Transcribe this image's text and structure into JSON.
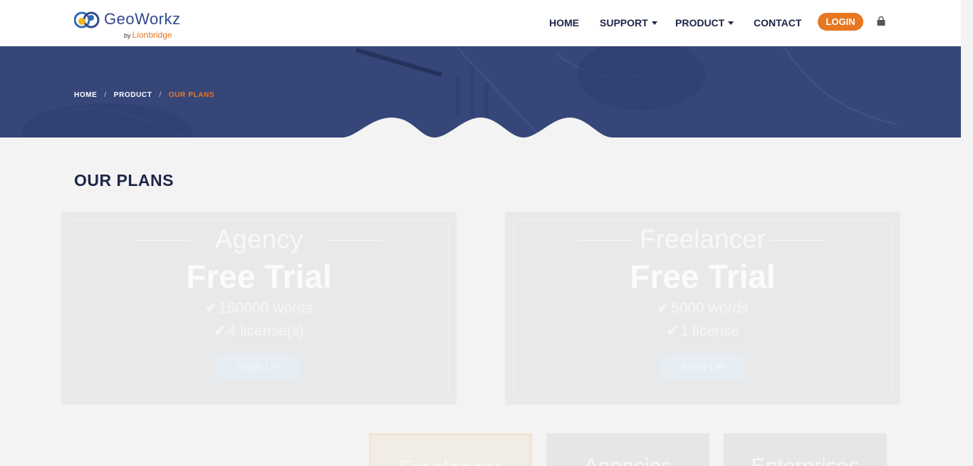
{
  "header": {
    "logo_brand": "GeoWorkz",
    "logo_by": "by",
    "logo_company": "Lionbridge",
    "nav": {
      "home": "HOME",
      "support": "SUPPORT",
      "product": "PRODUCT",
      "contact": "CONTACT"
    },
    "login_label": "LOGIN",
    "cart_icon": "shopping-bag-icon"
  },
  "breadcrumb": {
    "items": [
      "HOME",
      "PRODUCT",
      "OUR PLANS"
    ],
    "separator": "/"
  },
  "main": {
    "title": "OUR PLANS",
    "plans": [
      {
        "name": "Agency",
        "price": "Free Trial",
        "features": [
          "160000 words",
          "4 license(s)"
        ],
        "cta": "SIGN UP"
      },
      {
        "name": "Freelancer",
        "price": "Free Trial",
        "features": [
          "5000 words",
          "1 license"
        ],
        "cta": "SIGN UP"
      }
    ],
    "tiers": [
      "Freelancer",
      "Agencies",
      "Enterprises"
    ]
  },
  "colors": {
    "accent": "#e87722",
    "navy": "#1d2448",
    "hero": "#364679",
    "background": "#f3f3f3"
  }
}
